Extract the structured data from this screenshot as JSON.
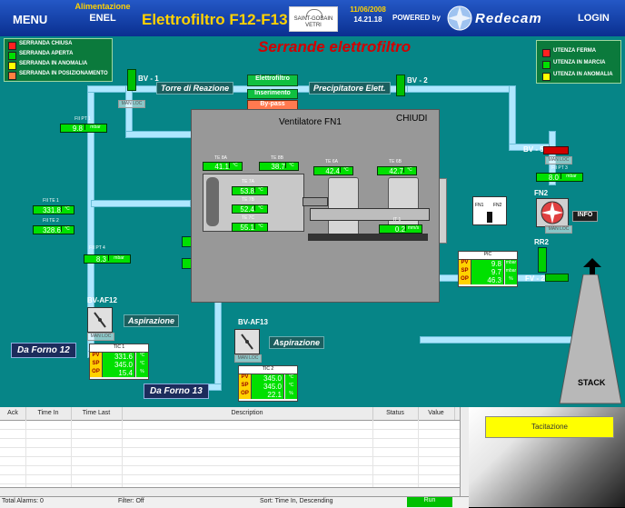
{
  "header": {
    "menu": "MENU",
    "alimentazione": "Alimentazione",
    "company": "ENEL",
    "title": "Elettrofiltro F12-F13",
    "sg_line1": "SAINT-GOBAIN",
    "sg_line2": "VETRI",
    "date": "11/06/2008",
    "time": "14.21.18",
    "powered_by": "POWERED by",
    "brand": "Redecam",
    "login": "LOGIN"
  },
  "legend_left": [
    {
      "label": "SERRANDA CHIUSA",
      "color": "#ff2020"
    },
    {
      "label": "SERRANDA APERTA",
      "color": "#00e000"
    },
    {
      "label": "SERRANDA IN ANOMALIA",
      "color": "#ffff00"
    },
    {
      "label": "SERRANDA IN POSIZIONAMENTO",
      "color": "#ff8040"
    }
  ],
  "legend_right": [
    {
      "label": "UTENZA FERMA",
      "color": "#ff2020"
    },
    {
      "label": "UTENZA IN MARCIA",
      "color": "#00e000"
    },
    {
      "label": "UTENZA IN ANOMALIA",
      "color": "#ffff00"
    }
  ],
  "scene": {
    "title": "Serrande elettrofiltro",
    "bv1": "BV - 1",
    "bv2": "BV - 2",
    "bv5": "BV - 5",
    "fv2": "FV - 2",
    "fn2": "FN2",
    "rr2": "RR2",
    "fn1_sw": "FN1",
    "fn2_sw": "FN2",
    "info": "INFO",
    "stack": "STACK",
    "torre": "Torre di Reazione",
    "precipitatore": "Precipitatore Elett.",
    "btn_elettrofiltro": "Elettrofiltro",
    "btn_inserimento": "Inserimento",
    "btn_bypass": "By-pass",
    "man_loc": "MAN LOC",
    "bvaf12": "BV-AF12",
    "bvaf13": "BV-AF13",
    "aspirazione": "Aspirazione",
    "forno12": "Da Forno 12",
    "forno13": "Da Forno 13"
  },
  "measures": {
    "fiipt1": {
      "tag": "FII PT 1",
      "value": "9.8",
      "unit": "mbar"
    },
    "fiite1": {
      "tag": "FII TE 1",
      "value": "331.8",
      "unit": "°C"
    },
    "fiite2": {
      "tag": "FII TE 2",
      "value": "328.6",
      "unit": "°C"
    },
    "fiipt4": {
      "tag": "FII PT 4",
      "value": "8.3",
      "unit": "mbar"
    },
    "fiipt3": {
      "tag": "FII PT 3",
      "value": "8.0",
      "unit": "mbar"
    },
    "bhidden": {
      "tag": "",
      "value": "",
      "unit": "mbar"
    }
  },
  "tic1": {
    "title": "TIC 1",
    "pv": "331.6",
    "sp": "345.0",
    "op": "15.4",
    "pv_u": "°C",
    "sp_u": "°C",
    "op_u": "%"
  },
  "tic2": {
    "title": "TIC 2",
    "pv": "345.0",
    "sp": "345.0",
    "op": "22.1",
    "pv_u": "°C",
    "sp_u": "°C",
    "op_u": "%"
  },
  "pic": {
    "title": "PIC",
    "pv": "9.8",
    "sp": "9.7",
    "op": "46.3",
    "pv_u": "mbar",
    "sp_u": "mbar",
    "op_u": "%"
  },
  "popup": {
    "title": "Ventilatore FN1",
    "close": "CHIUDI",
    "te8a": {
      "tag": "TE 8A",
      "value": "41.1",
      "unit": "°C"
    },
    "te8b": {
      "tag": "TE 8B",
      "value": "38.7",
      "unit": "°C"
    },
    "te6a": {
      "tag": "TE 6A",
      "value": "42.4",
      "unit": "°C"
    },
    "te6b": {
      "tag": "TE 6B",
      "value": "42.7",
      "unit": "°C"
    },
    "te7a": {
      "tag": "TE 7A",
      "value": "53.8",
      "unit": "°C"
    },
    "te7b": {
      "tag": "TE 7B",
      "value": "52.4",
      "unit": "°C"
    },
    "te7c": {
      "tag": "TE 7C",
      "value": "55.1",
      "unit": "°C"
    },
    "it1": {
      "tag": "IT 1",
      "value": "0.2",
      "unit": "mm/s"
    }
  },
  "alarm_table": {
    "headers": [
      "Ack",
      "Time In",
      "Time Last",
      "Description",
      "Status",
      "Value"
    ],
    "status_total": "Total Alarms: 0",
    "status_filter": "Filter: Off",
    "status_sort": "Sort: Time In, Descending",
    "status_run": "Run"
  },
  "tacitazione": "Tacitazione"
}
